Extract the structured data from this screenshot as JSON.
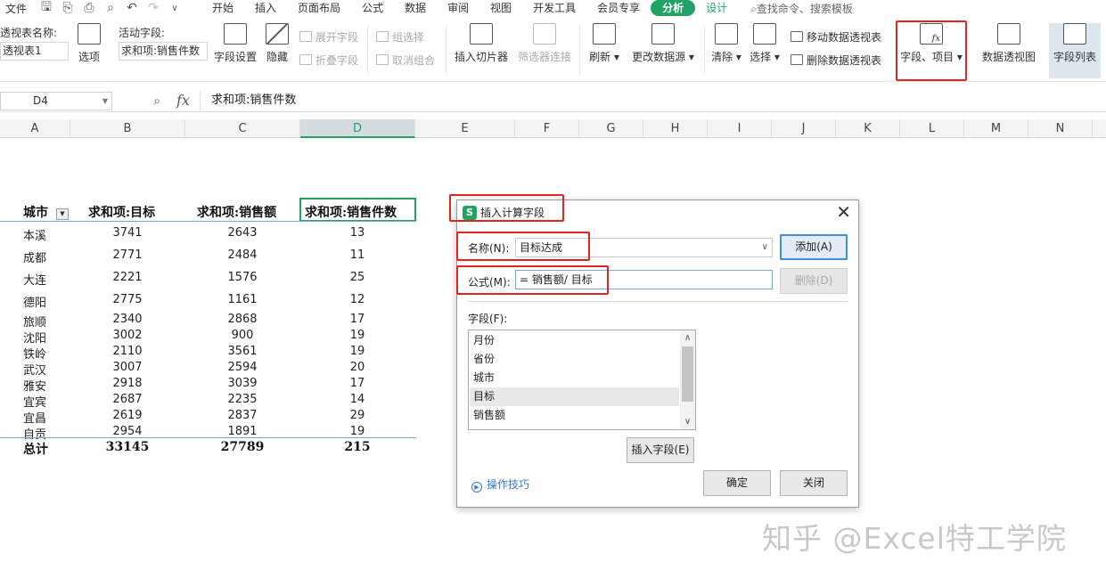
{
  "menubar": {
    "file": "文件",
    "tabs": [
      "开始",
      "插入",
      "页面布局",
      "公式",
      "数据",
      "审阅",
      "视图",
      "开发工具",
      "会员专享"
    ],
    "active_tab": "分析",
    "design_tab": "设计",
    "search": "查找命令、搜索模板"
  },
  "ribbon": {
    "pivot_name_label": "透视表名称:",
    "pivot_name_value": "透视表1",
    "options": "选项",
    "active_field_label": "活动字段:",
    "active_field_value": "求和项:销售件数",
    "field_settings": "字段设置",
    "hide": "隐藏",
    "expand_field": "展开字段",
    "collapse_field": "折叠字段",
    "group_selection": "组选择",
    "ungroup": "取消组合",
    "insert_slicer": "插入切片器",
    "filter_connections": "筛选器连接",
    "refresh": "刷新",
    "change_source": "更改数据源",
    "clear": "清除",
    "select": "选择",
    "move_pivot": "移动数据透视表",
    "delete_pivot": "删除数据透视表",
    "fields_items": "字段、项目",
    "pivot_chart": "数据透视图",
    "field_list": "字段列表"
  },
  "formula_bar": {
    "name_box": "D4",
    "fx": "fx",
    "content": "求和项:销售件数"
  },
  "columns": [
    "A",
    "B",
    "C",
    "D",
    "E",
    "F",
    "G",
    "H",
    "I",
    "J",
    "K",
    "L",
    "M",
    "N"
  ],
  "pivot": {
    "headers": [
      "城市",
      "求和项:目标",
      "求和项:销售额",
      "求和项:销售件数"
    ],
    "rows": [
      [
        "本溪",
        "3741",
        "2643",
        "13"
      ],
      [
        "成都",
        "2771",
        "2484",
        "11"
      ],
      [
        "大连",
        "2221",
        "1576",
        "25"
      ],
      [
        "德阳",
        "2775",
        "1161",
        "12"
      ],
      [
        "旅顺",
        "2340",
        "2868",
        "17"
      ],
      [
        "沈阳",
        "3002",
        "900",
        "19"
      ],
      [
        "铁岭",
        "2110",
        "3561",
        "19"
      ],
      [
        "武汉",
        "3007",
        "2594",
        "20"
      ],
      [
        "雅安",
        "2918",
        "3039",
        "17"
      ],
      [
        "宜宾",
        "2687",
        "2235",
        "14"
      ],
      [
        "宜昌",
        "2619",
        "2837",
        "29"
      ],
      [
        "自贡",
        "2954",
        "1891",
        "19"
      ]
    ],
    "total": [
      "总计",
      "33145",
      "27789",
      "215"
    ]
  },
  "dialog": {
    "title": "插入计算字段",
    "name_label": "名称(N):",
    "name_value": "目标达成",
    "formula_label": "公式(M):",
    "formula_value": "= 销售额/ 目标",
    "add_button": "添加(A)",
    "delete_button": "删除(D)",
    "fields_label": "字段(F):",
    "fields": [
      "月份",
      "省份",
      "城市",
      "目标",
      "销售额"
    ],
    "selected_field": "目标",
    "insert_field_button": "插入字段(E)",
    "tips": "操作技巧",
    "ok_button": "确定",
    "close_button": "关闭"
  },
  "watermark": "知乎 @Excel特工学院",
  "colors": {
    "accent_green": "#21a366",
    "highlight_red": "#e2261d",
    "primary_blue": "#3c8fd8"
  }
}
